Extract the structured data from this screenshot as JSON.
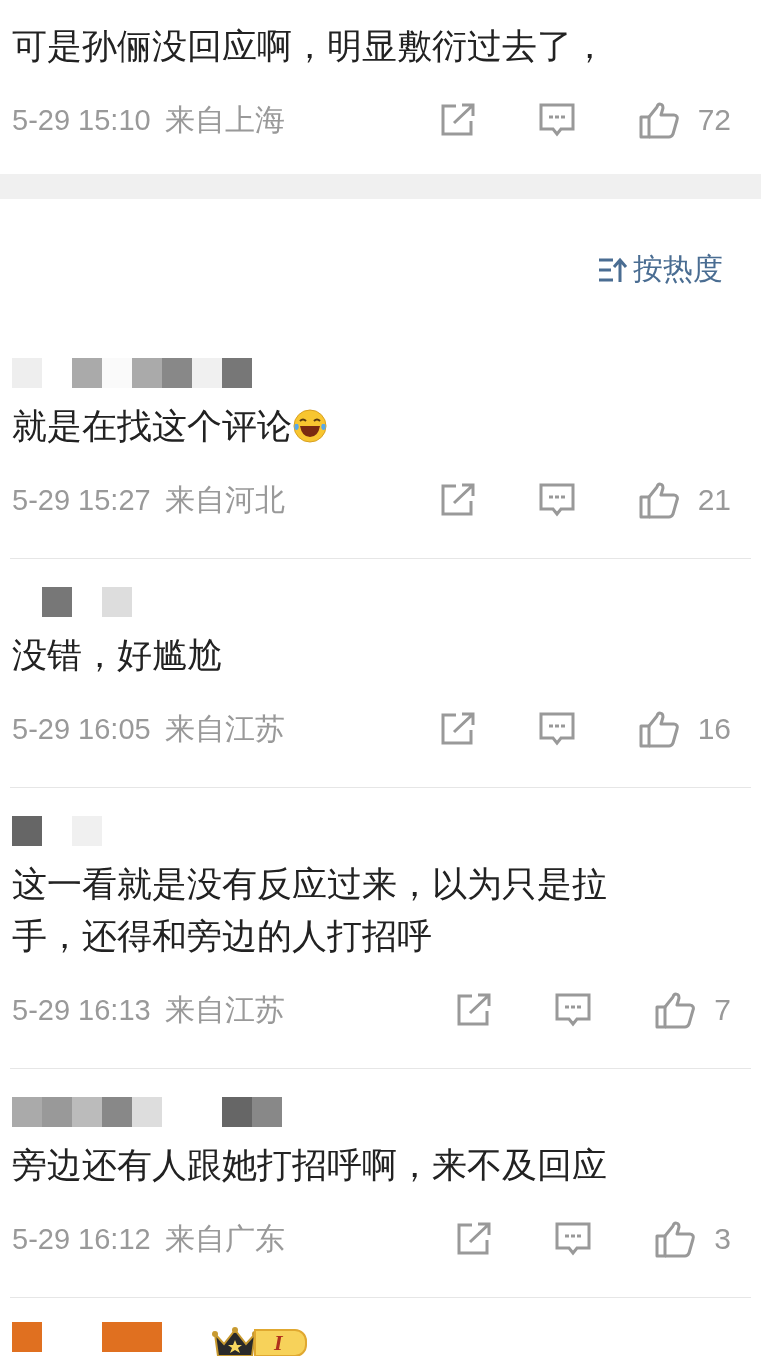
{
  "top_comment": {
    "text": "可是孙俪没回应啊，明显敷衍过去了，",
    "time": "5-29 15:10",
    "location": "来自上海",
    "likes": "72"
  },
  "sort_button": {
    "label": "按热度"
  },
  "comments": [
    {
      "text": "就是在找这个评论",
      "laughing_emoji": true,
      "time": "5-29 15:27",
      "location": "来自河北",
      "likes": "21"
    },
    {
      "text": "没错，好尴尬",
      "time": "5-29 16:05",
      "location": "来自江苏",
      "likes": "16"
    },
    {
      "text": "这一看就是没有反应过来，以为只是拉手，还得和旁边的人打招呼",
      "time": "5-29 16:13",
      "location": "来自江苏",
      "likes": "7"
    },
    {
      "text": "旁边还有人跟她打招呼啊，来不及回应",
      "time": "5-29 16:12",
      "location": "来自广东",
      "likes": "3"
    }
  ],
  "partial_comment": {
    "badge_level": "I"
  }
}
